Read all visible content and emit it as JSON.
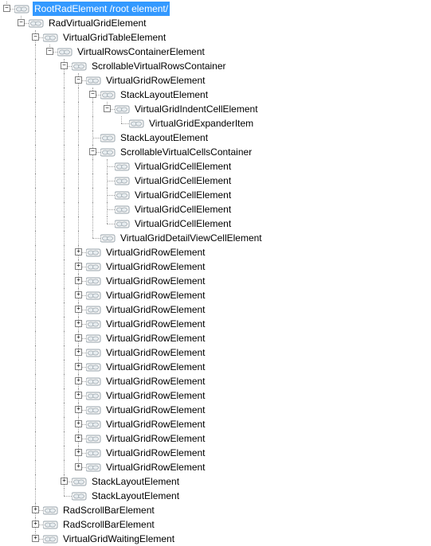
{
  "tree": {
    "label": "RootRadElement /root element/",
    "expanded": true,
    "selected": true,
    "children": [
      {
        "label": "RadVirtualGridElement",
        "expanded": true,
        "children": [
          {
            "label": "VirtualGridTableElement",
            "expanded": true,
            "children": [
              {
                "label": "VirtualRowsContainerElement",
                "expanded": true,
                "children": [
                  {
                    "label": "ScrollableVirtualRowsContainer",
                    "expanded": true,
                    "children": [
                      {
                        "label": "VirtualGridRowElement",
                        "expanded": true,
                        "children": [
                          {
                            "label": "StackLayoutElement",
                            "expanded": true,
                            "children": [
                              {
                                "label": "VirtualGridIndentCellElement",
                                "expanded": true,
                                "children": [
                                  {
                                    "label": "VirtualGridExpanderItem",
                                    "leaf": true
                                  }
                                ]
                              }
                            ]
                          },
                          {
                            "label": "StackLayoutElement",
                            "leaf": true
                          },
                          {
                            "label": "ScrollableVirtualCellsContainer",
                            "expanded": true,
                            "children": [
                              {
                                "label": "VirtualGridCellElement",
                                "leaf": true
                              },
                              {
                                "label": "VirtualGridCellElement",
                                "leaf": true
                              },
                              {
                                "label": "VirtualGridCellElement",
                                "leaf": true
                              },
                              {
                                "label": "VirtualGridCellElement",
                                "leaf": true
                              },
                              {
                                "label": "VirtualGridCellElement",
                                "leaf": true
                              }
                            ]
                          },
                          {
                            "label": "VirtualGridDetailViewCellElement",
                            "leaf": true
                          }
                        ]
                      },
                      {
                        "label": "VirtualGridRowElement",
                        "expanded": false,
                        "children": []
                      },
                      {
                        "label": "VirtualGridRowElement",
                        "expanded": false,
                        "children": []
                      },
                      {
                        "label": "VirtualGridRowElement",
                        "expanded": false,
                        "children": []
                      },
                      {
                        "label": "VirtualGridRowElement",
                        "expanded": false,
                        "children": []
                      },
                      {
                        "label": "VirtualGridRowElement",
                        "expanded": false,
                        "children": []
                      },
                      {
                        "label": "VirtualGridRowElement",
                        "expanded": false,
                        "children": []
                      },
                      {
                        "label": "VirtualGridRowElement",
                        "expanded": false,
                        "children": []
                      },
                      {
                        "label": "VirtualGridRowElement",
                        "expanded": false,
                        "children": []
                      },
                      {
                        "label": "VirtualGridRowElement",
                        "expanded": false,
                        "children": []
                      },
                      {
                        "label": "VirtualGridRowElement",
                        "expanded": false,
                        "children": []
                      },
                      {
                        "label": "VirtualGridRowElement",
                        "expanded": false,
                        "children": []
                      },
                      {
                        "label": "VirtualGridRowElement",
                        "expanded": false,
                        "children": []
                      },
                      {
                        "label": "VirtualGridRowElement",
                        "expanded": false,
                        "children": []
                      },
                      {
                        "label": "VirtualGridRowElement",
                        "expanded": false,
                        "children": []
                      },
                      {
                        "label": "VirtualGridRowElement",
                        "expanded": false,
                        "children": []
                      },
                      {
                        "label": "VirtualGridRowElement",
                        "expanded": false,
                        "children": []
                      }
                    ]
                  },
                  {
                    "label": "StackLayoutElement",
                    "expanded": false,
                    "children": []
                  },
                  {
                    "label": "StackLayoutElement",
                    "leaf": true
                  }
                ]
              }
            ]
          },
          {
            "label": "RadScrollBarElement",
            "expanded": false,
            "children": []
          },
          {
            "label": "RadScrollBarElement",
            "expanded": false,
            "children": []
          },
          {
            "label": "VirtualGridWaitingElement",
            "expanded": false,
            "children": []
          }
        ]
      }
    ]
  }
}
